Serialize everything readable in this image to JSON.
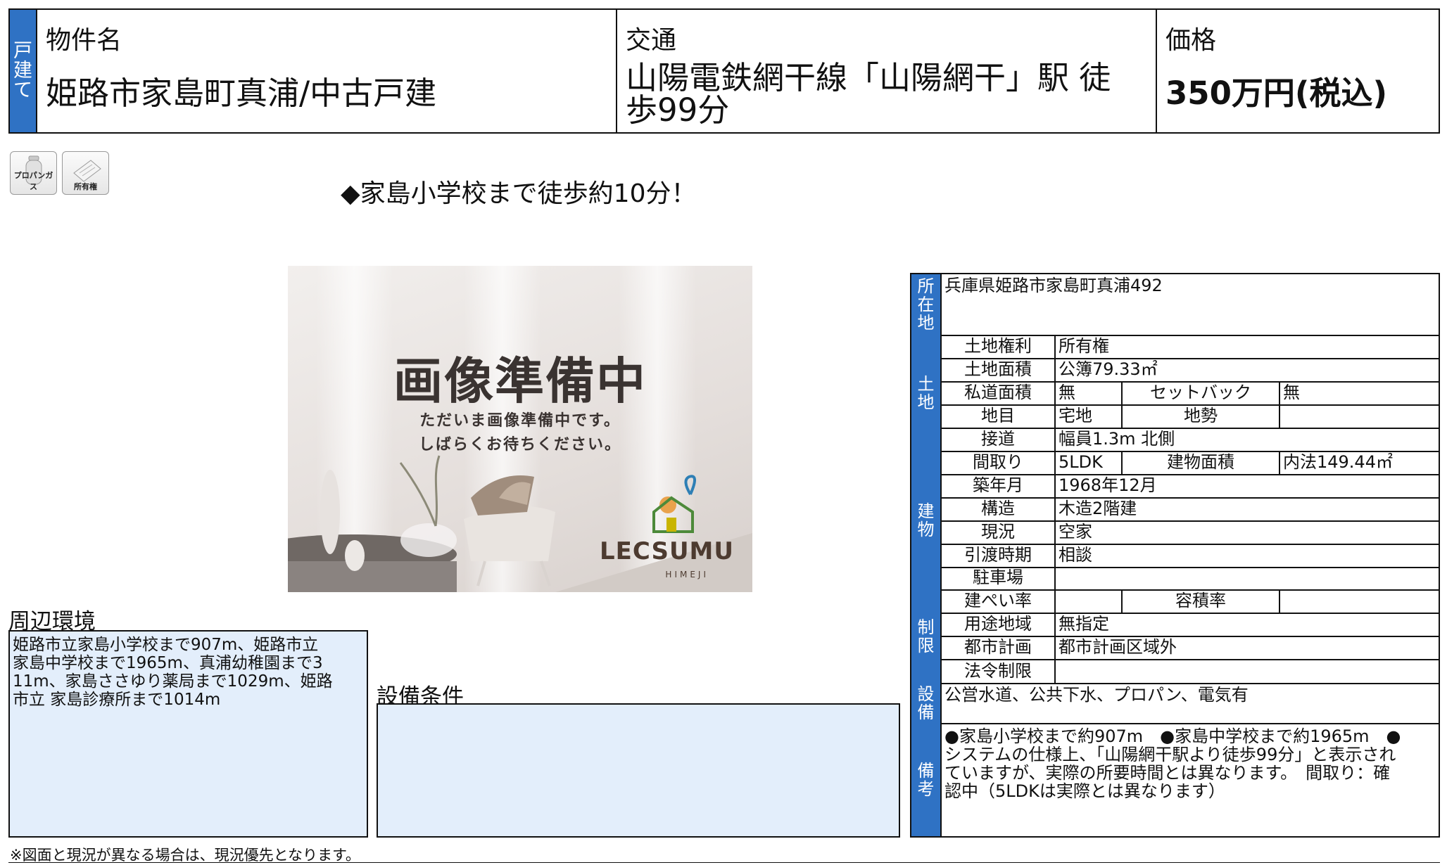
{
  "header": {
    "side_label": [
      "戸",
      "建",
      "て"
    ],
    "name_label": "物件名",
    "name_value": "姫路市家島町真浦/中古戸建",
    "transport_label": "交通",
    "transport_value_line1": "山陽電鉄網干線「山陽網干」駅 徒",
    "transport_value_line2": "歩99分",
    "price_label": "価格",
    "price_value": "350万円(税込)"
  },
  "icons": [
    {
      "name": "propane-gas-icon",
      "caption": "プロパンガス"
    },
    {
      "name": "ownership-icon",
      "caption": "所有権"
    }
  ],
  "headline": "◆家島小学校まで徒歩約10分！",
  "photo": {
    "title": "画像準備中",
    "line1": "ただいま画像準備中です。",
    "line2": "しばらくお待ちください。",
    "brand": "LECSUMU",
    "brand_sub": "HIMEJI"
  },
  "surroundings": {
    "label": "周辺環境",
    "lines": [
      "姫路市立家島小学校まで907m、姫路市立",
      "家島中学校まで1965m、真浦幼稚園まで3",
      "11m、家島ささゆり薬局まで1029m、姫路",
      "市立 家島診療所まで1014m"
    ]
  },
  "equipment": {
    "label": "設備条件",
    "value": ""
  },
  "spec": {
    "groups": {
      "location": [
        "所",
        "在",
        "地"
      ],
      "land": [
        "土",
        "地"
      ],
      "building": [
        "建",
        "物"
      ],
      "restrictions": [
        "制",
        "限"
      ],
      "facilities": [
        "設",
        "備"
      ],
      "remarks": [
        "備",
        "考"
      ]
    },
    "address": "兵庫県姫路市家島町真浦492",
    "land_rights_label": "土地権利",
    "land_rights": "所有権",
    "land_area_label": "土地面積",
    "land_area": "公簿79.33㎡",
    "private_road_label": "私道面積",
    "private_road": "無",
    "setback_label": "セットバック",
    "setback": "無",
    "land_category_label": "地目",
    "land_category": "宅地",
    "terrain_label": "地勢",
    "terrain": "",
    "road_access_label": "接道",
    "road_access": "幅員1.3m 北側",
    "layout_label": "間取り",
    "layout": "5LDK",
    "building_area_label": "建物面積",
    "building_area": "内法149.44㎡",
    "built_label": "築年月",
    "built": "1968年12月",
    "structure_label": "構造",
    "structure": "木造2階建",
    "status_label": "現況",
    "status": "空家",
    "handover_label": "引渡時期",
    "handover": "相談",
    "parking_label": "駐車場",
    "parking": "",
    "coverage_label": "建ぺい率",
    "coverage": "",
    "far_label": "容積率",
    "far": "",
    "zoning_label": "用途地域",
    "zoning": "無指定",
    "city_plan_label": "都市計画",
    "city_plan": "都市計画区域外",
    "legal_label": "法令制限",
    "legal": "",
    "facilities": "公営水道、公共下水、プロパン、電気有",
    "remarks_lines": [
      "●家島小学校まで約907m　●家島中学校まで約1965m　●",
      "システムの仕様上、「山陽網干駅より徒歩99分」と表示され",
      "ていますが、実際の所要時間とは異なります。　間取り：確",
      "認中（5LDKは実際とは異なります）"
    ]
  },
  "footnote": "※図面と現況が異なる場合は、現況優先となります。"
}
